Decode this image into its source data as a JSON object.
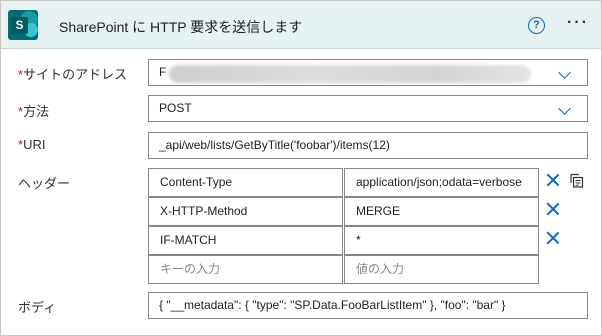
{
  "header": {
    "title": "SharePoint に HTTP 要求を送信します",
    "logo_letter": "S",
    "help_label": "?",
    "more_label": "···",
    "icons": {
      "logo": "sharepoint-logo",
      "help": "help-circle-icon",
      "more": "more-options-icon"
    }
  },
  "fields": {
    "site": {
      "required_mark": "*",
      "label": "サイトのアドレス",
      "value": "F",
      "redacted": true
    },
    "method": {
      "required_mark": "*",
      "label": "方法",
      "value": "POST"
    },
    "uri": {
      "required_mark": "*",
      "label": "URI",
      "value": "_api/web/lists/GetByTitle('foobar')/items(12)"
    },
    "headers": {
      "label": "ヘッダー",
      "rows": [
        {
          "key": "Content-Type",
          "value": "application/json;odata=verbose"
        },
        {
          "key": "X-HTTP-Method",
          "value": "MERGE"
        },
        {
          "key": "IF-MATCH",
          "value": "*"
        }
      ],
      "key_placeholder": "キーの入力",
      "value_placeholder": "値の入力"
    },
    "body": {
      "label": "ボディ",
      "value": "{ \"__metadata\": { \"type\": \"SP.Data.FooBarListItem\" }, \"foo\": \"bar\" }"
    }
  },
  "colors": {
    "header_bg": "#e6f1f2",
    "accent": "#0f6cbd",
    "required": "#a4262c",
    "brand": "#036c70"
  }
}
